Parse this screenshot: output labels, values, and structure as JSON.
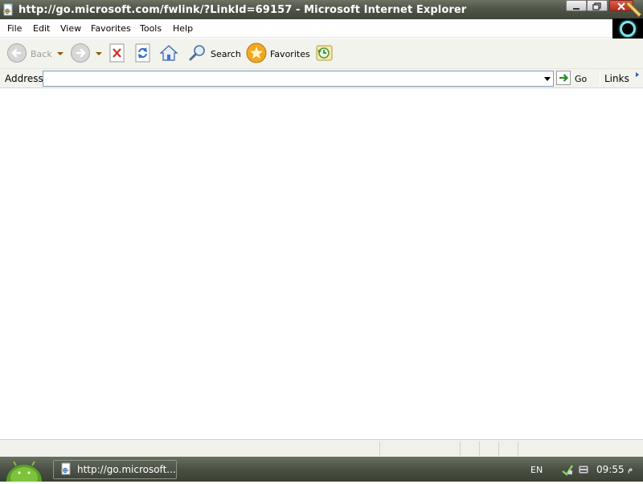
{
  "window": {
    "title": "http://go.microsoft.com/fwlink/?LinkId=69157 - Microsoft Internet Explorer"
  },
  "menu": {
    "items": [
      "File",
      "Edit",
      "View",
      "Favorites",
      "Tools",
      "Help"
    ]
  },
  "toolbar": {
    "back_label": "Back",
    "search_label": "Search",
    "favorites_label": "Favorites"
  },
  "address_bar": {
    "label": "Address",
    "value": "",
    "go_label": "Go",
    "links_label": "Links"
  },
  "taskbar": {
    "task_label": "http://go.microsoft...",
    "language": "EN",
    "clock": "09:55",
    "clock_suffix": "م"
  },
  "icons": {
    "app": "ie-page-icon",
    "back": "back-arrow-icon",
    "forward": "forward-arrow-icon",
    "stop": "stop-icon",
    "refresh": "refresh-icon",
    "home": "home-icon",
    "search": "search-magnifier-icon",
    "favorites": "favorites-star-icon",
    "history": "history-icon",
    "go": "go-arrow-icon"
  },
  "colors": {
    "titlebar": "#50564a",
    "toolbar_bg": "#f3f3ee",
    "address_border": "#7f9db9",
    "stop_red": "#d03020",
    "accent_blue": "#1c5fb8"
  }
}
